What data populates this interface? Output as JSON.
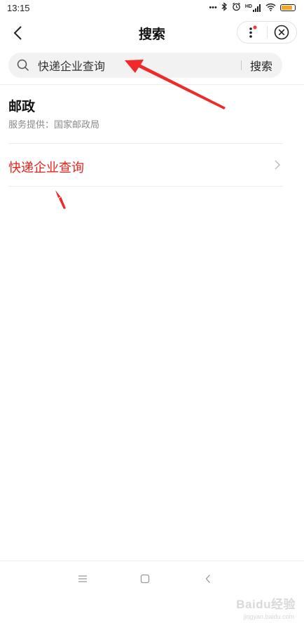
{
  "status_bar": {
    "time": "13:15",
    "icons": [
      "dots-icon",
      "bluetooth-icon",
      "alarm-icon",
      "hd-signal-icon",
      "wifi-icon",
      "battery-icon"
    ],
    "signal_label": "HD",
    "dots": "•••"
  },
  "nav": {
    "title": "搜索"
  },
  "search": {
    "value": "快递企业查询",
    "button_label": "搜索"
  },
  "result": {
    "title": "邮政",
    "provider": "服务提供：国家邮政局",
    "service_label": "快递企业查询"
  },
  "watermark": {
    "text": "Baidu经验",
    "sub": "jingyan.baidu.com"
  },
  "colors": {
    "accent_red": "#e8231c",
    "annotation_red": "#ee2a2a",
    "dot_red": "#f23c3c",
    "battery": "#f5a623"
  }
}
